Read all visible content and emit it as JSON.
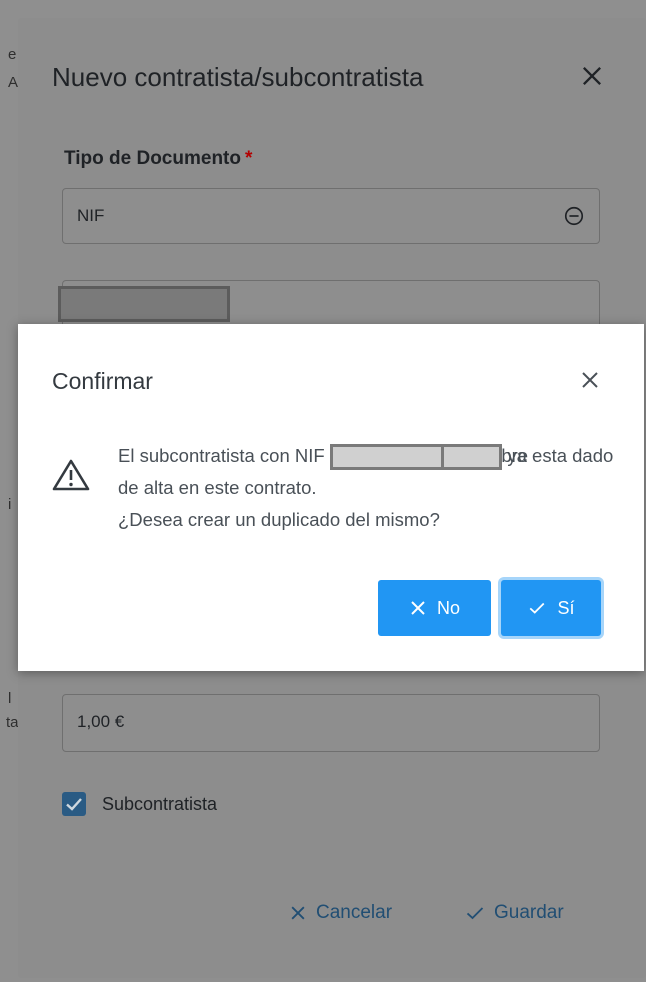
{
  "background_dialog": {
    "title": "Nuevo contratista/subcontratista",
    "document_type_label": "Tipo de Documento",
    "required_mark": "*",
    "document_type_value": "NIF",
    "amount_value": "1,00 €",
    "subcontractor_checkbox_label": "Subcontratista",
    "subcontractor_checked": true,
    "cancel_label": "Cancelar",
    "save_label": "Guardar"
  },
  "background_page": {
    "edge_letters": [
      "e",
      "A",
      "i",
      "l",
      "ta"
    ]
  },
  "confirm_dialog": {
    "title": "Confirmar",
    "message_part1": "El subcontratista con NIF",
    "message_part2": "y nombre",
    "message_part3": "ya esta dado de alta en este contrato.",
    "message_part4": "¿Desea crear un duplicado del mismo?",
    "no_label": "No",
    "yes_label": "Sí"
  },
  "colors": {
    "primary_button": "#2196f3",
    "overlay_text_link": "#214e73",
    "required": "#b30000"
  }
}
